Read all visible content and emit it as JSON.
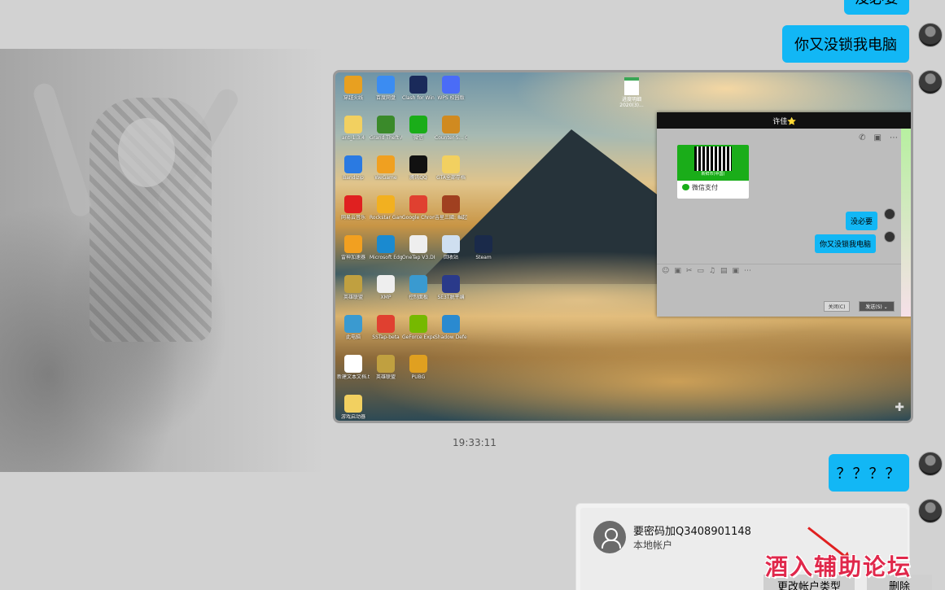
{
  "messages": {
    "top_partial": "没必要",
    "msg1": "你又没锁我电脑",
    "timestamp": "19:33:11",
    "msg2": "？？？？"
  },
  "screenshot": {
    "desktop_icons": [
      {
        "label": "穿越火线",
        "color": "#e8a020"
      },
      {
        "label": "百度网盘",
        "color": "#3b8cf2"
      },
      {
        "label": "Clash for Windows",
        "color": "#1a2a5a"
      },
      {
        "label": "WPS 校园版",
        "color": "#4a6cf7"
      },
      {
        "label": "ant_1.3.4",
        "color": "#f2d060"
      },
      {
        "label": "Grand Theft Auto V",
        "color": "#3a8a2a"
      },
      {
        "label": "微信",
        "color": "#1aad19"
      },
      {
        "label": "Counter-S... Global Off...",
        "color": "#d08a20"
      },
      {
        "label": "Bandizip",
        "color": "#2a7ae2"
      },
      {
        "label": "WeGame",
        "color": "#f0a020"
      },
      {
        "label": "腾讯QQ",
        "color": "#111111"
      },
      {
        "label": "GTA全部存档",
        "color": "#f2d060"
      },
      {
        "label": "网易云音乐",
        "color": "#e02020"
      },
      {
        "label": "Rockstar Games...",
        "color": "#f2b020"
      },
      {
        "label": "Google Chrome",
        "color": "#e04030"
      },
      {
        "label": "吉星三國: 崛起",
        "color": "#a04020"
      },
      {
        "label": "雷神加速器",
        "color": "#f2a020"
      },
      {
        "label": "Microsoft Edge",
        "color": "#1a8ad0"
      },
      {
        "label": "OneTap V3.DLL",
        "color": "#eeeeee"
      },
      {
        "label": "回收站",
        "color": "#cfdff0"
      },
      {
        "label": "Steam",
        "color": "#1a2a4a"
      },
      {
        "label": "英雄联盟",
        "color": "#c0a040"
      },
      {
        "label": "XMP",
        "color": "#eeeeee"
      },
      {
        "label": "控制面板",
        "color": "#3a9ad0"
      },
      {
        "label": "SE3T脱平编",
        "color": "#2a3a8a"
      },
      {
        "label": "此电脑",
        "color": "#3a9ad0"
      },
      {
        "label": "SSTap-beta",
        "color": "#e04030"
      },
      {
        "label": "GeForce Experience",
        "color": "#76b900"
      },
      {
        "label": "Shadow Defender",
        "color": "#2a8ad0"
      },
      {
        "label": "新建文本文档.txt",
        "color": "#ffffff"
      },
      {
        "label": "英雄联盟",
        "color": "#c0a040"
      },
      {
        "label": "PUBG",
        "color": "#e0a020"
      },
      {
        "label": "游戏启动器",
        "color": "#f2d060"
      }
    ],
    "file_label": "进度明细 2020(3)...",
    "qq_window": {
      "title": "许佳⭐",
      "tools": [
        "✆",
        "▣",
        "⋯"
      ],
      "qr_sub": "新鲜市(中国)",
      "qr_pay": "微信支付",
      "bubble1": "没必要",
      "bubble2": "你又没锁我电脑",
      "input_icons": "☺▣✂▭♫▤▣⋯",
      "close_btn": "关闭(C)",
      "send_btn": "发送(S) ⌄"
    },
    "expand": "✚"
  },
  "account": {
    "name": "要密码加Q3408901148",
    "type": "本地帐户",
    "change_type_btn": "更改帐户类型",
    "delete_btn": "删除"
  },
  "watermark": "酒入辅助论坛"
}
